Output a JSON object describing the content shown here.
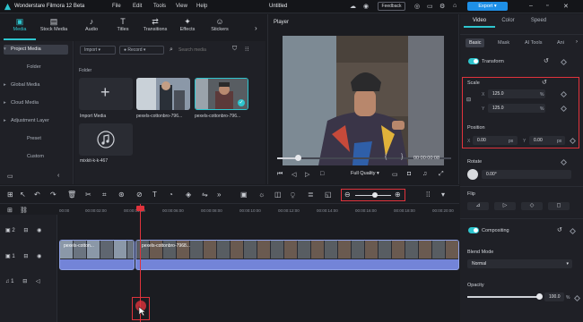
{
  "titlebar": {
    "app_name": "Wonderstare Filmora 12 Beta",
    "menu": [
      "File",
      "Edit",
      "Tools",
      "View",
      "Help"
    ],
    "project": "Untitled",
    "feedback": "Feedback",
    "export": "Export"
  },
  "media_tabs": [
    {
      "label": "Media",
      "icon": "media-icon"
    },
    {
      "label": "Stock Media",
      "icon": "stock-media-icon"
    },
    {
      "label": "Audio",
      "icon": "audio-icon"
    },
    {
      "label": "Titles",
      "icon": "titles-icon"
    },
    {
      "label": "Transitions",
      "icon": "transitions-icon"
    },
    {
      "label": "Effects",
      "icon": "effects-icon"
    },
    {
      "label": "Stickers",
      "icon": "stickers-icon"
    }
  ],
  "left_nav": {
    "items": [
      "Project Media",
      "Folder",
      "Global Media",
      "Cloud Media",
      "Adjustment Layer",
      "Preset",
      "Custom"
    ]
  },
  "media": {
    "import_dropdown": "Import",
    "record_dropdown": "Record",
    "search_placeholder": "Search media",
    "folder_label": "Folder",
    "items": [
      {
        "label": "Import Media"
      },
      {
        "label": "pexels-cottonbro-796..."
      },
      {
        "label": "pexels-cottonbro-796..."
      },
      {
        "label": "mixkit-k-k-467"
      }
    ]
  },
  "player": {
    "title": "Player",
    "timecode": "00:00:00:08",
    "quality": "Full Quality",
    "progress": 0.12
  },
  "right_panel": {
    "tabs": [
      "Video",
      "Color",
      "Speed"
    ],
    "subtabs": [
      "Basic",
      "Mask",
      "AI Tools",
      "Ani"
    ],
    "transform_label": "Transform",
    "scale_label": "Scale",
    "scale_x_label": "X",
    "scale_x": "125.0",
    "scale_y_label": "Y",
    "scale_y": "125.0",
    "unit_pct": "%",
    "position_label": "Position",
    "pos_x_label": "X",
    "pos_x": "0.00",
    "pos_y_label": "Y",
    "pos_y": "0.00",
    "unit_px": "px",
    "rotate_label": "Rotate",
    "rotate_value": "0.00°",
    "flip_label": "Flip",
    "compositing_label": "Compositing",
    "blend_mode_label": "Blend Mode",
    "blend_mode_value": "Normal",
    "opacity_label": "Opacity",
    "opacity_value": "100.0",
    "opacity_level": 1.0
  },
  "timeline": {
    "ruler_ticks": [
      "00:00",
      "00:00:02:00",
      "00:00:04:00",
      "00:00:06:00",
      "00:00:08:00",
      "00:00:10:00",
      "00:00:12:00",
      "00:00:14:00",
      "00:00:16:00",
      "00:00:18:00",
      "00:00:20:00"
    ],
    "track_labels": [
      "2",
      "1",
      "1"
    ],
    "clip1_label": "pexels-cotton...",
    "clip2_label": "pexels-cottonbro-7968..."
  },
  "colors": {
    "accent": "#2ec5ce",
    "export_blue": "#1e8fe6",
    "highlight_red": "#e0333c",
    "clip_blue": "#7384d8"
  }
}
